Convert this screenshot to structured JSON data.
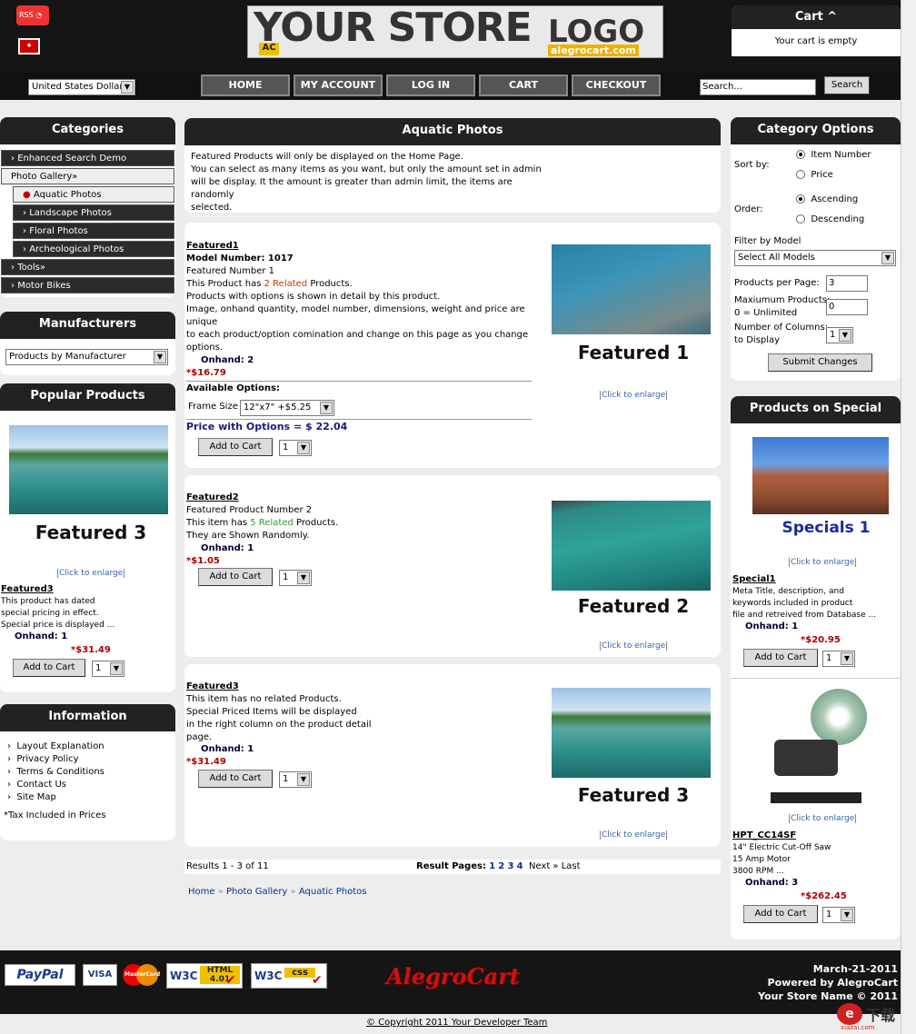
{
  "header": {
    "logo_main": "YOUR STORE",
    "logo_word": "LOGO",
    "logo_ac": "AC",
    "logo_sub": "alegrocart.com",
    "currency": "United States Dollar",
    "search_placeholder": "Search...",
    "search_btn": "Search"
  },
  "cart": {
    "title": "Cart ^",
    "message": "Your cart is empty"
  },
  "nav": [
    "HOME",
    "MY ACCOUNT",
    "LOG IN",
    "CART",
    "CHECKOUT"
  ],
  "categories": {
    "title": "Categories",
    "items": [
      "Enhanced Search Demo",
      "Photo Gallery»",
      "Aquatic Photos",
      "Landscape Photos",
      "Floral Photos",
      "Archeological Photos",
      "Tools»",
      "Motor Bikes"
    ]
  },
  "manufacturers": {
    "title": "Manufacturers",
    "select": "Products by Manufacturer"
  },
  "popular": {
    "title": "Popular Products",
    "img_label": "Featured 3",
    "enlarge": "Click to enlarge",
    "name": "Featured3",
    "desc1": "This product has dated",
    "desc2": "special pricing in effect.",
    "desc3": "Special price is displayed ...",
    "onhand": "Onhand: 1",
    "price": "*$31.49",
    "add": "Add to Cart",
    "qty": "1"
  },
  "information": {
    "title": "Information",
    "links": [
      "Layout Explanation",
      "Privacy Policy",
      "Terms & Conditions",
      "Contact Us",
      "Site Map"
    ],
    "tax": "*Tax Included in Prices"
  },
  "main": {
    "title": "Aquatic Photos",
    "intro": [
      "Featured Products will only be displayed on the Home Page.",
      "You can select as many items as you want, but only the amount set in admin",
      "will be display. It the amount is greater than admin limit, the items are randomly",
      "selected."
    ],
    "p1": {
      "name": "Featured1",
      "model": "Model Number: 1017",
      "l1": "Featured Number 1",
      "l2a": "This Product has ",
      "l2b": "2 Related",
      "l2c": " Products.",
      "l3": "Products with options is shown in detail by this product.",
      "l4": "Image, onhand quantity, model number, dimensions, weight and price are",
      "l5": "unique",
      "l6": "to each product/option comination and change on this page as you change",
      "l7": "options.",
      "onhand": "Onhand: 2",
      "price": "*$16.79",
      "opts": "Available Options:",
      "frame": "Frame Size",
      "frame_val": "12\"x7\" +$5.25",
      "pwo": "Price with Options = $ 22.04",
      "add": "Add to Cart",
      "qty": "1",
      "img": "Featured 1",
      "enlarge": "Click to enlarge"
    },
    "p2": {
      "name": "Featured2",
      "l1": "Featured Product Number 2",
      "l2a": "This item has ",
      "l2b": "5 Related",
      "l2c": " Products.",
      "l3": "They are Shown Randomly.",
      "onhand": "Onhand: 1",
      "price": "*$1.05",
      "add": "Add to Cart",
      "qty": "1",
      "img": "Featured 2",
      "enlarge": "Click to enlarge"
    },
    "p3": {
      "name": "Featured3",
      "l1": "This item has no related Products.",
      "l2": "Special Priced Items will be displayed",
      "l3": "in the right column on the product detail",
      "l4": "page.",
      "onhand": "Onhand: 1",
      "price": "*$31.49",
      "add": "Add to Cart",
      "qty": "1",
      "img": "Featured 3",
      "enlarge": "Click to enlarge"
    },
    "results": "Results 1 - 3 of 11",
    "pages_label": "Result Pages:",
    "pages": [
      "1",
      "2",
      "3",
      "4"
    ],
    "next": "Next »",
    "last": "Last",
    "crumbs": [
      "Home",
      "Photo Gallery",
      "Aquatic Photos"
    ]
  },
  "catopts": {
    "title": "Category Options",
    "sort": "Sort by:",
    "sort_opts": [
      "Item Number",
      "Price"
    ],
    "order": "Order:",
    "order_opts": [
      "Ascending",
      "Descending"
    ],
    "filter": "Filter by Model",
    "filter_val": "Select All Models",
    "ppp": "Products per Page:",
    "ppp_val": "3",
    "maxp": "Maxiumum Products:",
    "maxp2": "0 = Unlimited",
    "maxp_val": "0",
    "cols": "Number of Columns:",
    "cols2": "to Display",
    "cols_val": "1",
    "submit": "Submit Changes"
  },
  "specials": {
    "title": "Products on Special",
    "img": "Specials 1",
    "enlarge": "Click to enlarge",
    "name": "Special1",
    "d1": "Meta Title, description, and",
    "d2": "keywords included in product",
    "d3": "file and retreived from Database ...",
    "onhand": "Onhand: 1",
    "price": "*$20.95",
    "add": "Add to Cart",
    "qty": "1",
    "name2": "HPT_CC14SF",
    "e1": "14\" Electric Cut-Off Saw",
    "e2": "15 Amp Motor",
    "e3": "3800 RPM ...",
    "onhand2": "Onhand: 3",
    "price2": "*$262.45"
  },
  "footer": {
    "date": "March-21-2011",
    "powered": "Powered by AlegroCart",
    "store": "Your Store Name © 2011",
    "brand": "AlegroCart",
    "copyright": "© Copyright 2011 Your Developer Team",
    "paypal": "PayPal",
    "visa": "VISA",
    "mc": "MasterCard",
    "w3c_html": "HTML 4.01",
    "w3c_css": "css",
    "w3c": "W3C",
    "watermark": "下载",
    "watermark_site": "xiazai.com"
  }
}
